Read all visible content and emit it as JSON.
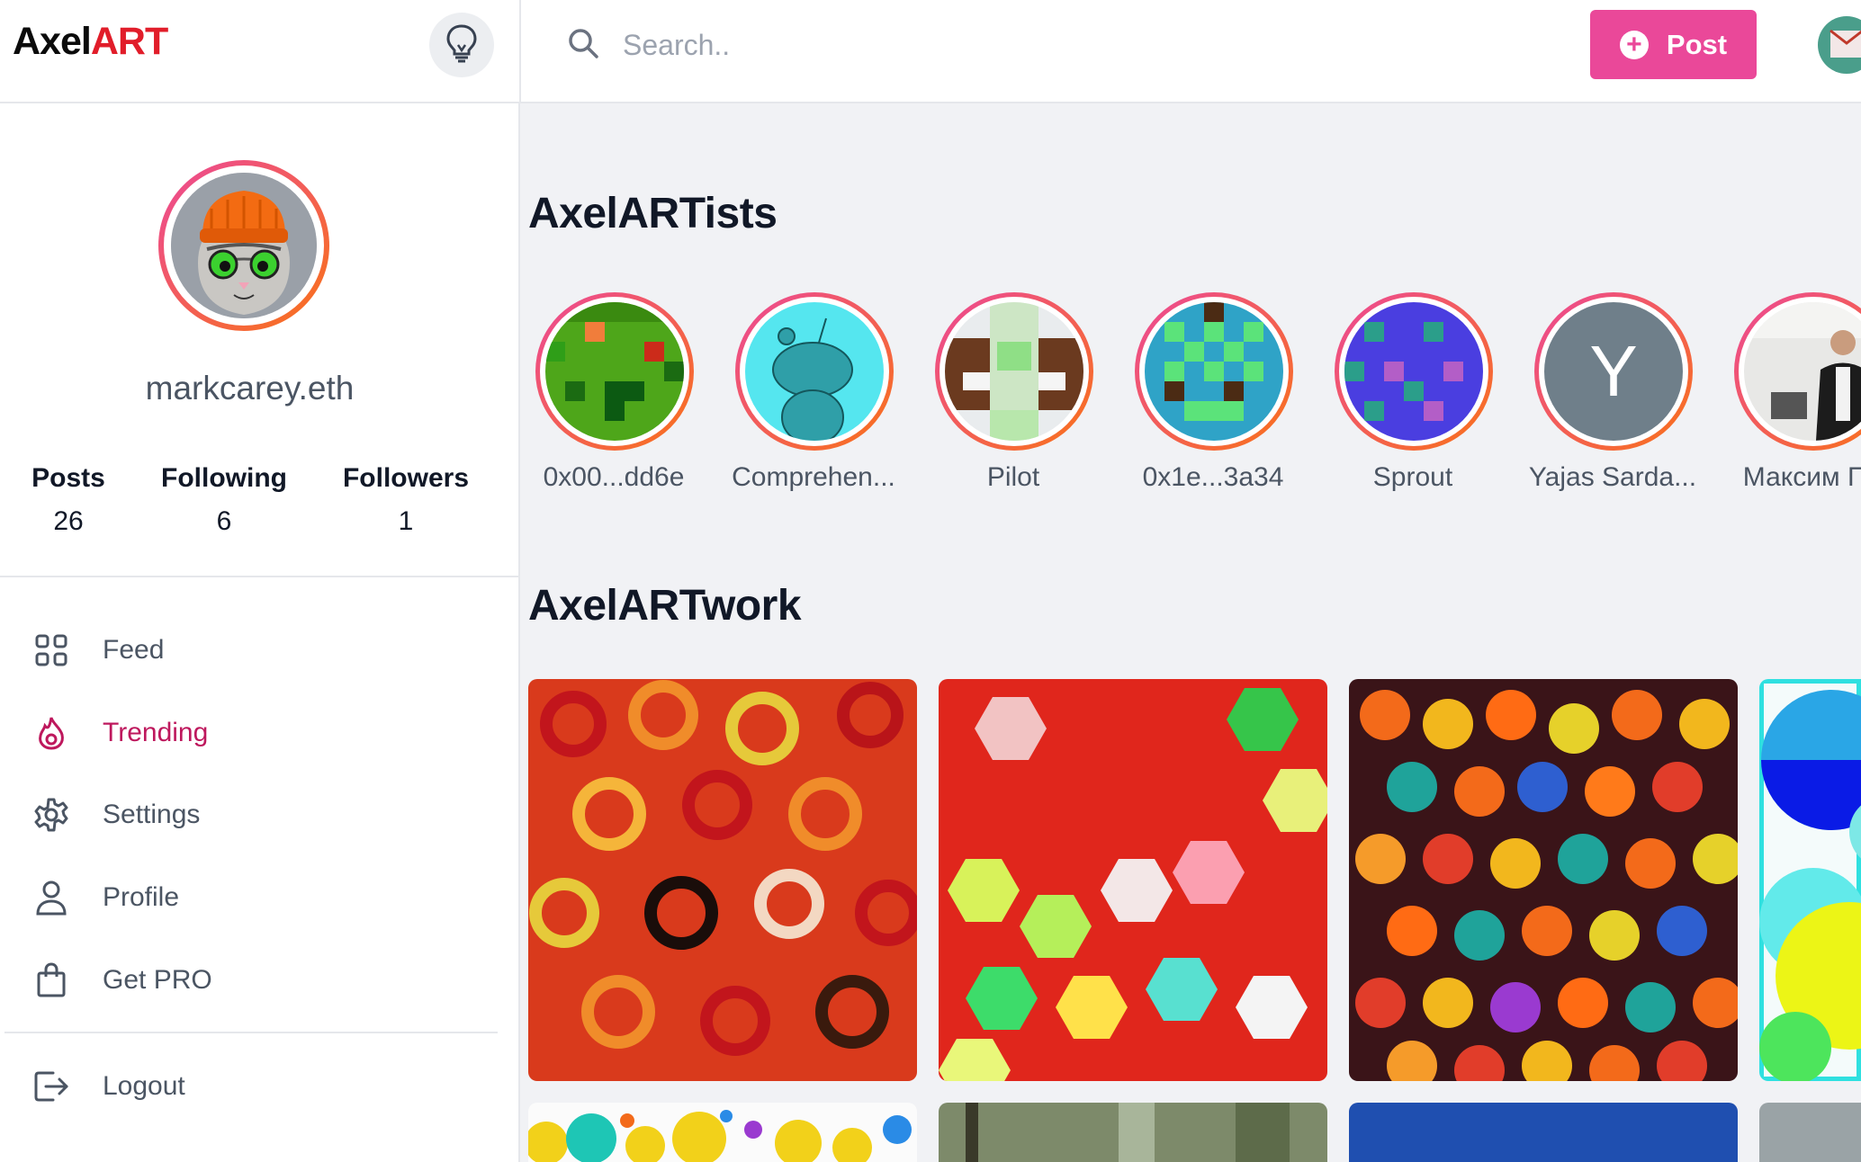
{
  "app": {
    "logo_part1": "Axel",
    "logo_part2": "ART"
  },
  "search": {
    "placeholder": "Search.."
  },
  "header": {
    "post_label": "Post"
  },
  "profile": {
    "username": "markcarey.eth",
    "stats": [
      {
        "label": "Posts",
        "value": "26"
      },
      {
        "label": "Following",
        "value": "6"
      },
      {
        "label": "Followers",
        "value": "1"
      }
    ]
  },
  "nav": {
    "items": [
      {
        "label": "Feed",
        "icon": "grid-icon"
      },
      {
        "label": "Trending",
        "icon": "fire-icon",
        "active": true
      },
      {
        "label": "Settings",
        "icon": "gear-icon"
      },
      {
        "label": "Profile",
        "icon": "user-icon"
      },
      {
        "label": "Get PRO",
        "icon": "shopping-bag-icon"
      }
    ],
    "logout_label": "Logout"
  },
  "sections": {
    "artists_title": "AxelARTists",
    "artwork_title": "AxelARTwork"
  },
  "artists": [
    {
      "name": "0x00...dd6e"
    },
    {
      "name": "Comprehen..."
    },
    {
      "name": "Pilot"
    },
    {
      "name": "0x1e...3a34"
    },
    {
      "name": "Sprout"
    },
    {
      "name": "Yajas Sarda...",
      "initial": "Y"
    },
    {
      "name": "Максим Пе"
    }
  ],
  "colors": {
    "accent_pink": "#ea4899",
    "active_nav": "#be185d",
    "logo_red": "#e11d2a"
  }
}
